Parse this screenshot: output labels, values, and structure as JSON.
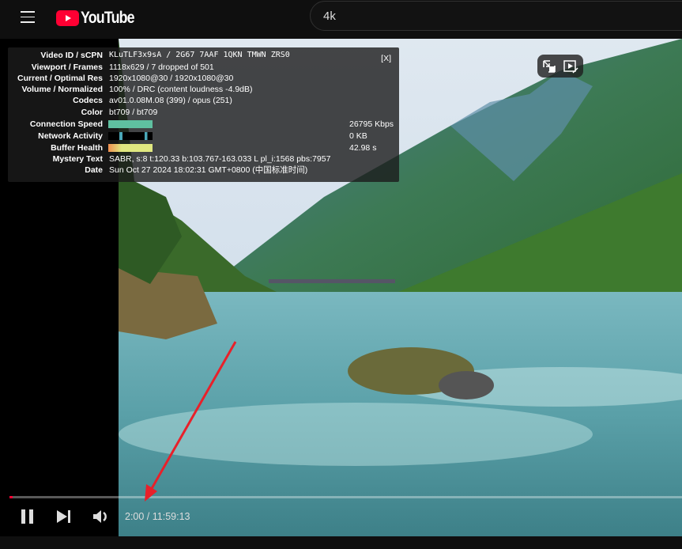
{
  "header": {
    "logo_text": "YouTube",
    "search_value": "4k"
  },
  "stats": {
    "close_label": "[X]",
    "rows": [
      {
        "label": "Video ID / sCPN",
        "value": "KLuTLF3x9sA  /  2G67 7AAF 1QKN TMWN ZRS0"
      },
      {
        "label": "Viewport / Frames",
        "value": "1118x629 / 7 dropped of 501"
      },
      {
        "label": "Current / Optimal Res",
        "value": "1920x1080@30 / 1920x1080@30"
      },
      {
        "label": "Volume / Normalized",
        "value": "100% / DRC (content loudness -4.9dB)"
      },
      {
        "label": "Codecs",
        "value": "av01.0.08M.08 (399) / opus (251)"
      },
      {
        "label": "Color",
        "value": "bt709 / bt709"
      },
      {
        "label": "Connection Speed",
        "value": "26795 Kbps"
      },
      {
        "label": "Network Activity",
        "value": "0 KB"
      },
      {
        "label": "Buffer Health",
        "value": "42.98 s"
      },
      {
        "label": "Mystery Text",
        "value": "SABR, s:8 t:120.33 b:103.767-163.033 L pl_i:1568 pbs:7957"
      },
      {
        "label": "Date",
        "value": "Sun Oct 27 2024 18:02:31 GMT+0800 (中国标准时间)"
      }
    ],
    "colors": {
      "connection": "#5fc0a0",
      "network": "#4aa8b8",
      "buffer": "#e0e880"
    }
  },
  "player": {
    "time": "2:00 / 11:59:13",
    "progress_percent": 0.28,
    "icons": [
      "pause-icon",
      "next-icon",
      "volume-icon",
      "exit-miniplayer-icon",
      "autoplay-icon"
    ],
    "accent": "#ff0033"
  }
}
